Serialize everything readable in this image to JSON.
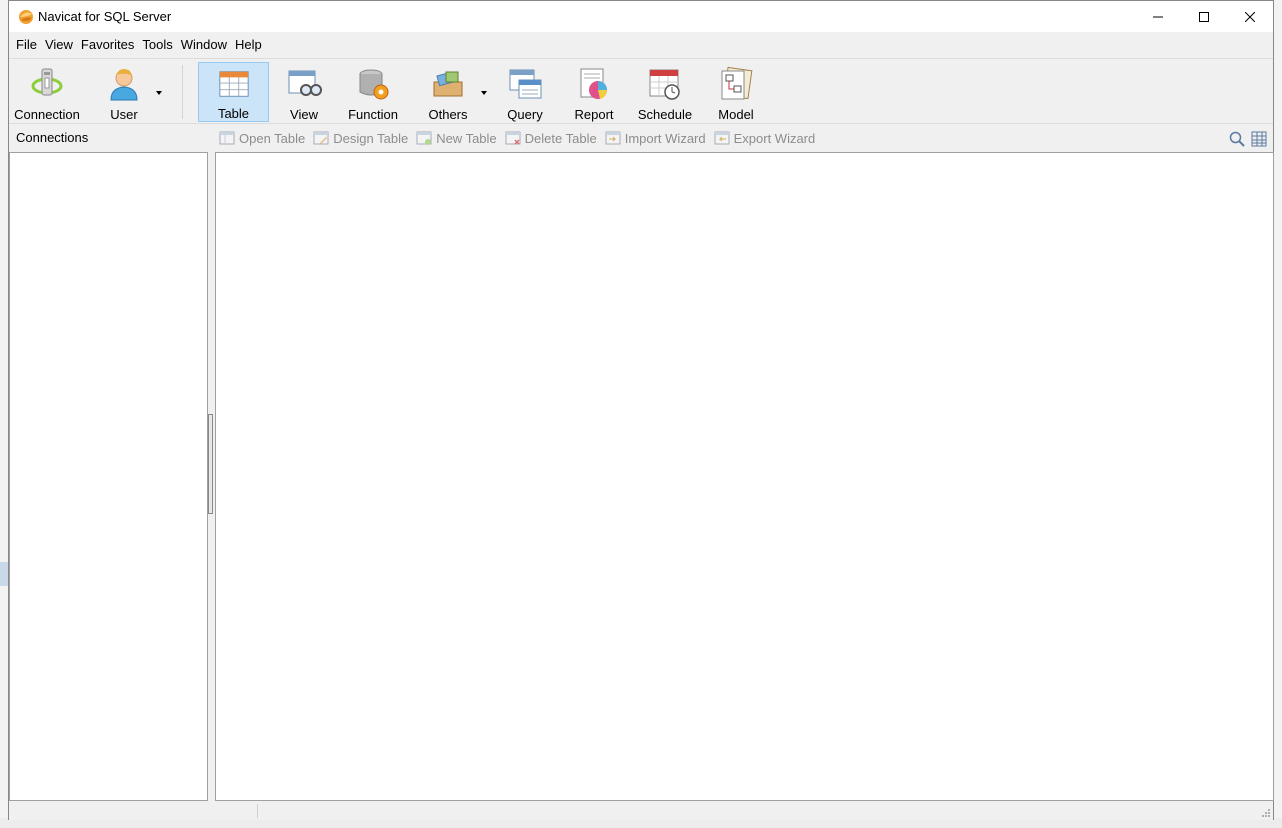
{
  "window": {
    "title": "Navicat for SQL Server",
    "accent": "#cce4f7"
  },
  "menu": [
    "File",
    "View",
    "Favorites",
    "Tools",
    "Window",
    "Help"
  ],
  "toolbar": {
    "items": [
      {
        "label": "Connection",
        "icon": "connection-icon"
      },
      {
        "label": "User",
        "icon": "user-icon"
      },
      {
        "label": "Table",
        "icon": "table-icon",
        "active": true
      },
      {
        "label": "View",
        "icon": "view-icon"
      },
      {
        "label": "Function",
        "icon": "function-icon"
      },
      {
        "label": "Others",
        "icon": "others-icon"
      },
      {
        "label": "Query",
        "icon": "query-icon"
      },
      {
        "label": "Report",
        "icon": "report-icon"
      },
      {
        "label": "Schedule",
        "icon": "schedule-icon"
      },
      {
        "label": "Model",
        "icon": "model-icon"
      }
    ]
  },
  "connections": {
    "header": "Connections"
  },
  "object_toolbar": {
    "items": [
      "Open Table",
      "Design Table",
      "New Table",
      "Delete Table",
      "Import Wizard",
      "Export Wizard"
    ]
  }
}
